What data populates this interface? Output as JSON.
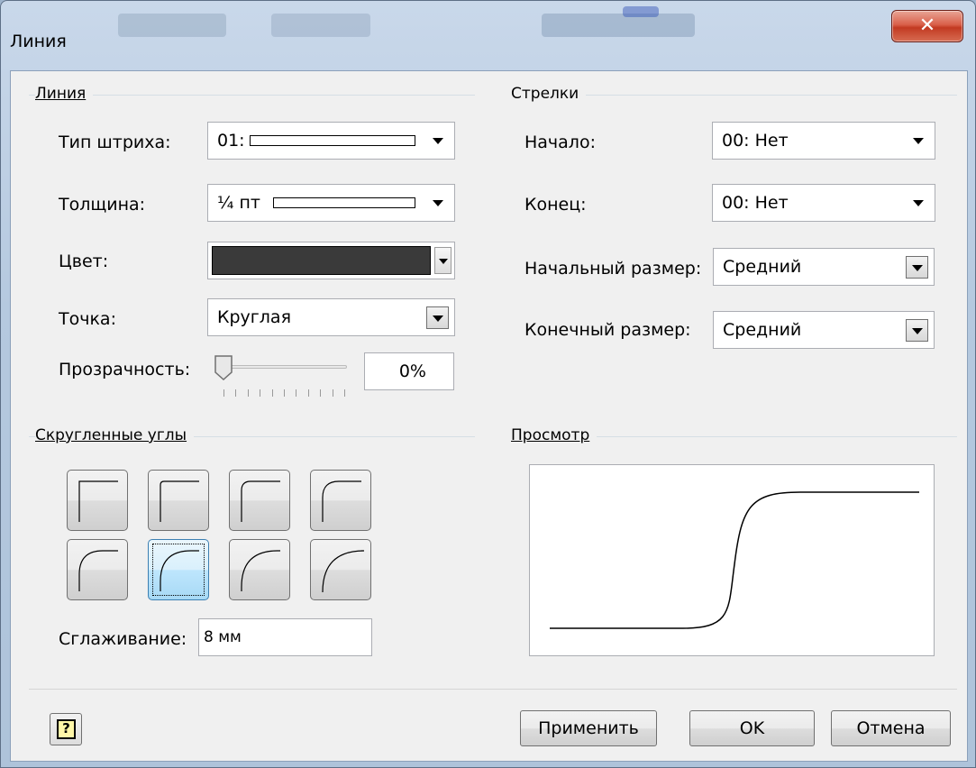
{
  "window": {
    "title": "Линия",
    "close_symbol": "✕"
  },
  "line_group": {
    "title": "Линия",
    "dash_type": {
      "label": "Тип штриха:",
      "value": "01:"
    },
    "weight": {
      "label": "Толщина:",
      "value": "¼ пт"
    },
    "color": {
      "label": "Цвет:",
      "swatch": "#3a3a3a"
    },
    "cap": {
      "label": "Точка:",
      "value": "Круглая"
    },
    "transparency": {
      "label": "Прозрачность:",
      "value": "0%",
      "level": 0
    }
  },
  "arrows_group": {
    "title": "Стрелки",
    "begin": {
      "label": "Начало:",
      "value": "00: Нет"
    },
    "end": {
      "label": "Конец:",
      "value": "00: Нет"
    },
    "begin_size": {
      "label": "Начальный размер:",
      "value": "Средний"
    },
    "end_size": {
      "label": "Конечный размер:",
      "value": "Средний"
    }
  },
  "corners_group": {
    "title": "Скругленные углы",
    "selected_index": 5,
    "smoothing": {
      "label": "Сглаживание:",
      "value": "8 мм"
    }
  },
  "preview_group": {
    "title": "Просмотр"
  },
  "buttons": {
    "apply": "Применить",
    "ok": "OK",
    "cancel": "Отмена",
    "help": "?"
  }
}
